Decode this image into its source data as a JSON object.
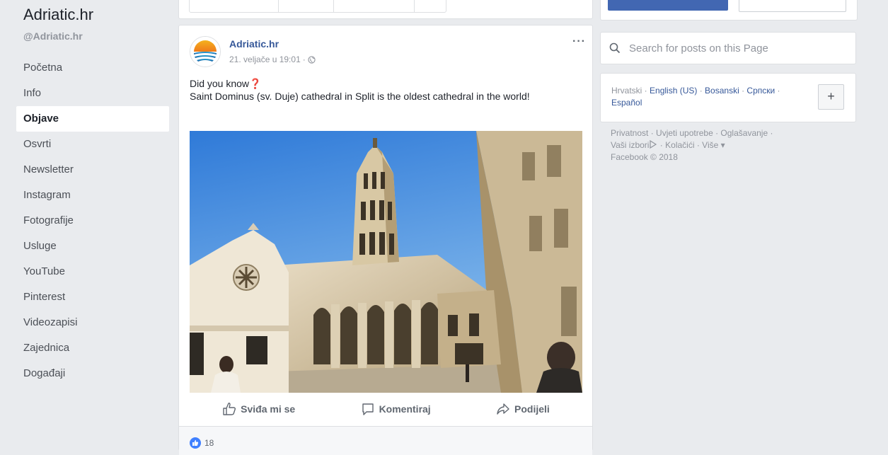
{
  "page": {
    "name": "Adriatic.hr",
    "handle": "@Adriatic.hr"
  },
  "nav": {
    "items": [
      "Početna",
      "Info",
      "Objave",
      "Osvrti",
      "Newsletter",
      "Instagram",
      "Fotografije",
      "Usluge",
      "YouTube",
      "Pinterest",
      "Videozapisi",
      "Zajednica",
      "Događaji"
    ],
    "active": "Objave"
  },
  "post": {
    "author": "Adriatic.hr",
    "timestamp": "21. veljače u 19:01",
    "separator": "·",
    "more": "···",
    "text_line1": "Did you know",
    "text_emoji": "❓",
    "text_line2": "Saint Dominus (sv. Duje) cathedral in Split is the oldest cathedral in the world!",
    "actions": {
      "like": "Sviđa mi se",
      "comment": "Komentiraj",
      "share": "Podijeli"
    },
    "like_count": "18"
  },
  "search": {
    "placeholder": "Search for posts on this Page"
  },
  "languages": {
    "current": "Hrvatski",
    "links": [
      "English (US)",
      "Bosanski",
      "Српски",
      "Español"
    ],
    "sep": " · ",
    "add": "+"
  },
  "footer": {
    "links_line1": [
      "Privatnost",
      "Uvjeti upotrebe",
      "Oglašavanje"
    ],
    "adchoices": "Vaši izbori",
    "links_line2": [
      "Kolačići",
      "Više ▾"
    ],
    "copyright": "Facebook © 2018",
    "sep": " · "
  },
  "colors": {
    "brand_blue": "#4267b2",
    "link_blue": "#365899",
    "background": "#e9ebee"
  }
}
